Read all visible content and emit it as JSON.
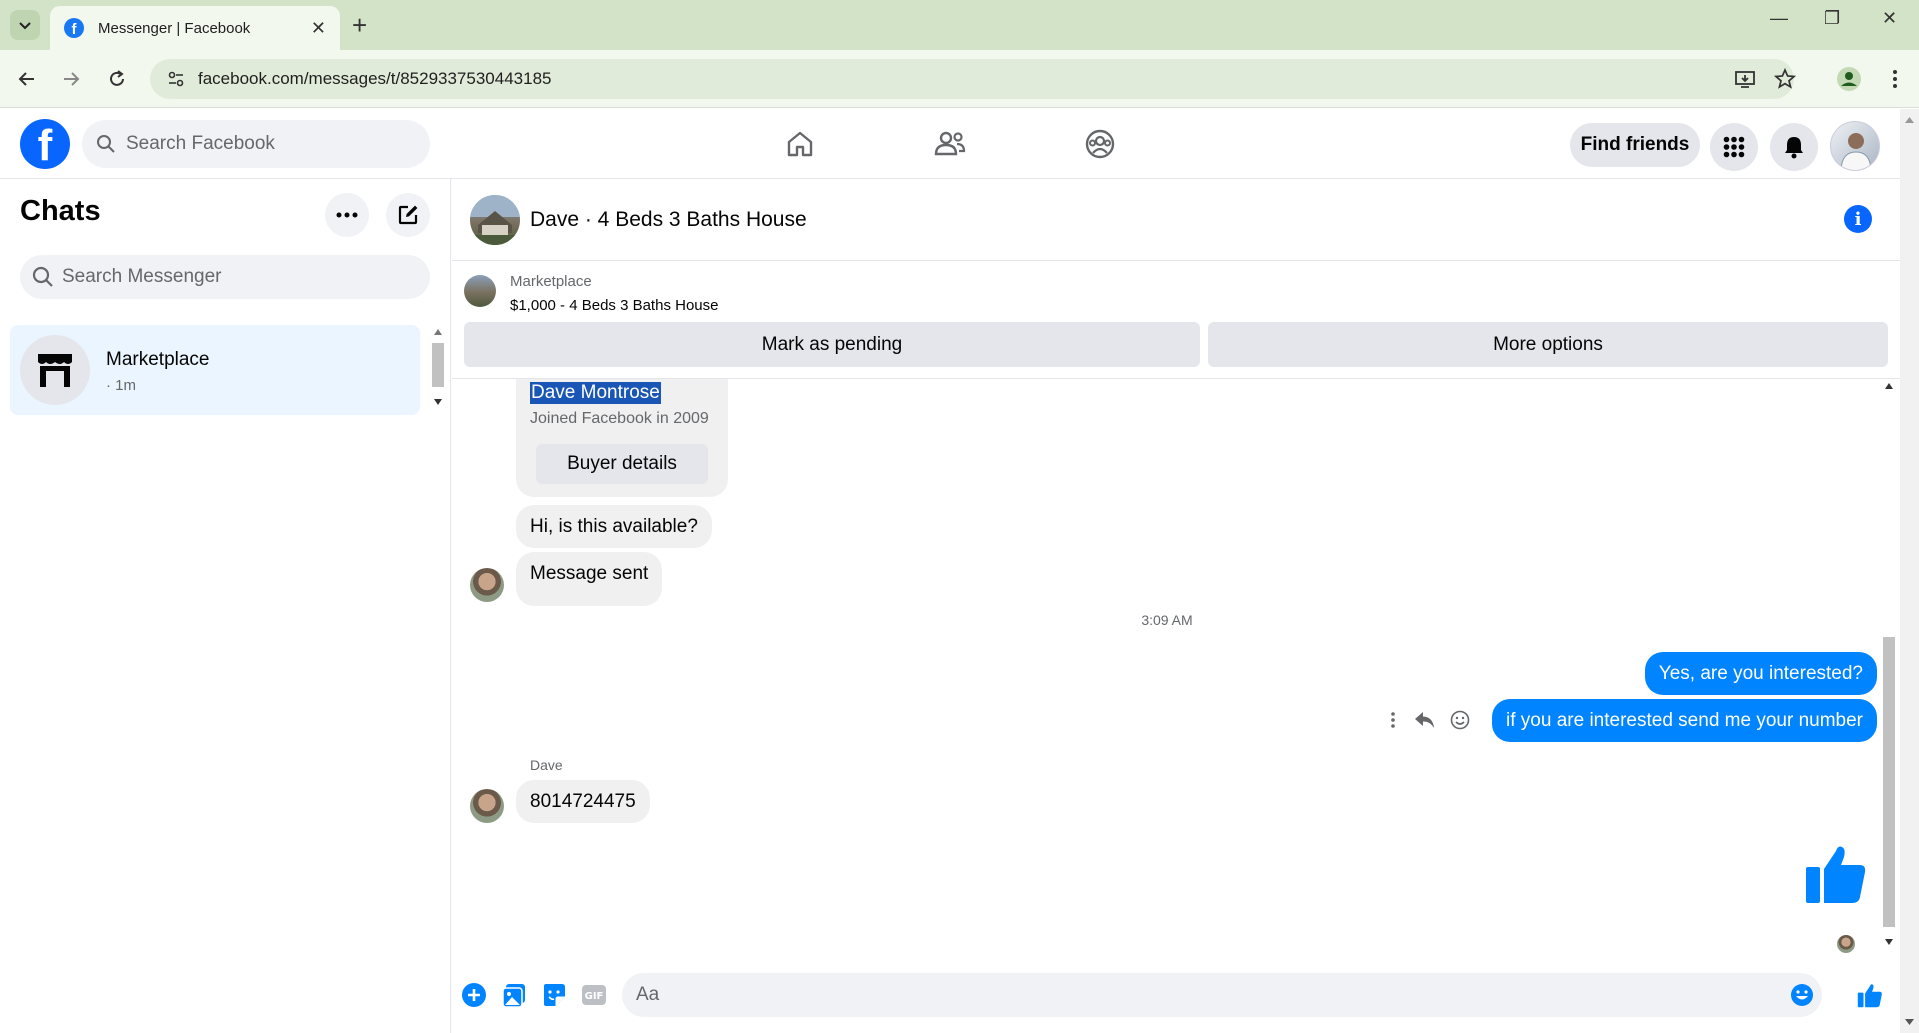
{
  "browser": {
    "tab_title": "Messenger | Facebook",
    "tab_close": "✕",
    "new_tab": "+",
    "url": "facebook.com/messages/t/8529337530443185",
    "window_controls": [
      "—",
      "❐",
      "✕"
    ]
  },
  "fb_header": {
    "logo": "f",
    "search_placeholder": "Search Facebook",
    "find_friends_label": "Find friends",
    "nav_icons": [
      "home-icon",
      "friends-icon",
      "groups-icon"
    ]
  },
  "chats_panel": {
    "title": "Chats",
    "search_placeholder": "Search Messenger",
    "items": [
      {
        "name": "Marketplace",
        "time": "· 1m"
      }
    ]
  },
  "conversation": {
    "title": "Dave · 4 Beds 3 Baths House",
    "marketplace": {
      "label": "Marketplace",
      "price_line": "$1,000 - 4 Beds 3 Baths House",
      "mark_pending_label": "Mark as pending",
      "more_options_label": "More options"
    },
    "buyer_card": {
      "name": "Dave Montrose",
      "joined": "Joined Facebook in 2009",
      "buyer_details_label": "Buyer details"
    },
    "messages": {
      "in_1": "Hi, is this available?",
      "in_2": "Message sent",
      "timestamp": "3:09 AM",
      "out_1": "Yes, are you interested?",
      "out_2": "if you are interested send me your number",
      "sender_label": "Dave",
      "in_3": "8014724475"
    },
    "compose_placeholder": "Aa"
  },
  "colors": {
    "fb_blue": "#0866ff",
    "outgoing_bubble": "#0084ff",
    "incoming_bubble": "#f0f0f0",
    "chrome_frame": "#d3e3c7",
    "chrome_toolbar": "#f3f8ef"
  }
}
